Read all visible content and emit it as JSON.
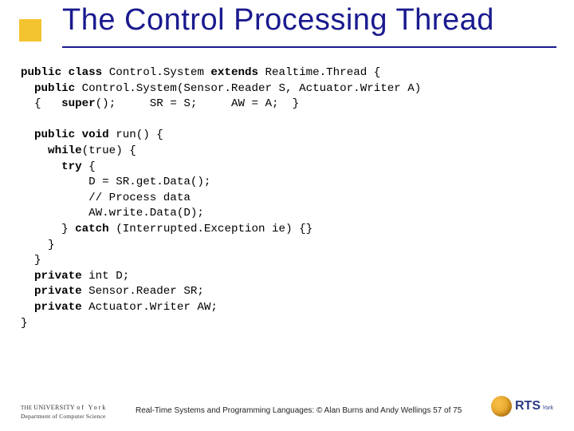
{
  "title": "The Control Processing Thread",
  "code": {
    "l01a": "public class ",
    "l01b": "Control.System ",
    "l01c": "extends ",
    "l01d": "Realtime.Thread {",
    "l02a": "  public ",
    "l02b": "Control.System(Sensor.Reader S, Actuator.Writer A)",
    "l03a": "  {   ",
    "l03b": "super",
    "l03c": "();     SR = S;     AW = A;  }",
    "l04": "",
    "l05a": "  public void ",
    "l05b": "run() {",
    "l06a": "    while",
    "l06b": "(true) {",
    "l07a": "      try ",
    "l07b": "{",
    "l08": "          D = SR.get.Data();",
    "l09": "          // Process data",
    "l10": "          AW.write.Data(D);",
    "l11a": "      } ",
    "l11b": "catch ",
    "l11c": "(Interrupted.Exception ie) {}",
    "l12": "    }",
    "l13": "  }",
    "l14a": "  private ",
    "l14b": "int D;",
    "l15a": "  private ",
    "l15b": "Sensor.Reader SR;",
    "l16a": "  private ",
    "l16b": "Actuator.Writer AW;",
    "l17": "}"
  },
  "footer": {
    "uni_line1_the": "THE ",
    "uni_line1_mid": "UNIVERSITY ",
    "uni_line1_york": "of York",
    "uni_dept": "Department of Computer Science",
    "caption": "Real-Time Systems and Programming Languages: © Alan Burns and Andy Wellings  57 of 75",
    "rts": "RTS",
    "rts_sub": "York"
  }
}
